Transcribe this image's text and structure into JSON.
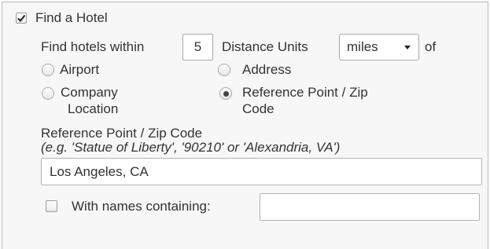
{
  "find_hotel": {
    "checkbox_label": "Find a Hotel",
    "checked": true
  },
  "search_row": {
    "prefix": "Find hotels within",
    "distance_value": "5",
    "units_label": "Distance Units",
    "units_selected": "miles",
    "suffix": "of"
  },
  "location_options": [
    {
      "label": "Airport",
      "selected": false
    },
    {
      "label": "Address",
      "selected": false
    },
    {
      "label": "Company Location",
      "line1": "Company",
      "line2": "Location",
      "selected": false
    },
    {
      "label": "Reference Point / Zip Code",
      "line1": "Reference Point / Zip",
      "line2": "Code",
      "selected": true
    }
  ],
  "reference": {
    "label": "Reference Point / Zip Code",
    "hint": "(e.g. 'Statue of Liberty', '90210' or 'Alexandria, VA')",
    "value": "Los Angeles, CA"
  },
  "names": {
    "label": "With names containing:",
    "checked": false,
    "value": ""
  }
}
